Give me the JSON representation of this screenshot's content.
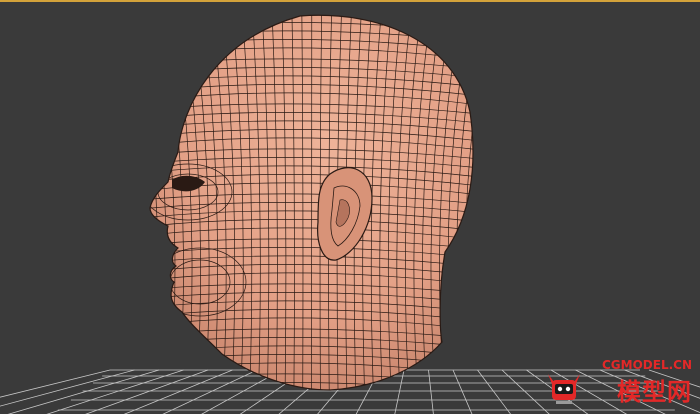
{
  "viewport": {
    "background_color": "#3a3a3a",
    "active_border_color": "#d3a23a",
    "grid_color": "#c8c8c8"
  },
  "model": {
    "skin_color": "#e3a086",
    "wire_color": "#2a1a14",
    "shadow_color": "#b0705c"
  },
  "watermark": {
    "url_text": "CGMODEL.CN",
    "name_text": "模型网",
    "color": "#e32828",
    "logo_icon": "robot-mascot-icon"
  }
}
